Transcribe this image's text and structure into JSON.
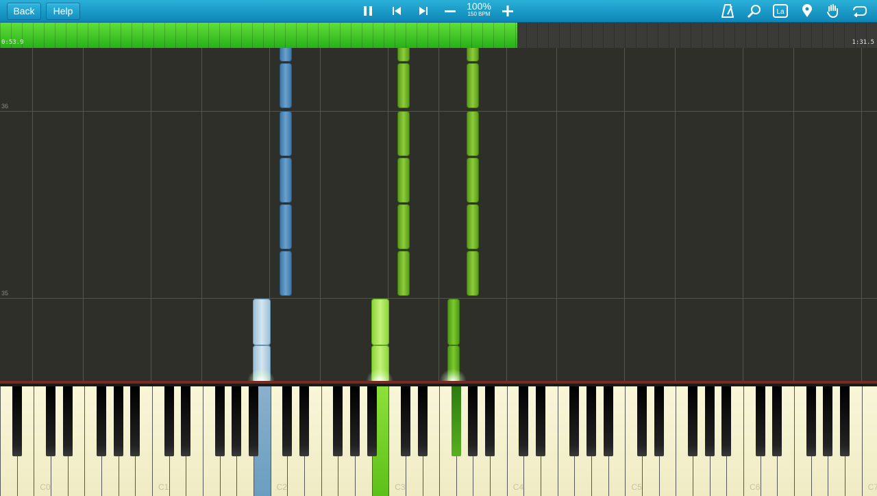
{
  "toolbar": {
    "back_label": "Back",
    "help_label": "Help",
    "speed_percent": "100%",
    "speed_bpm": "150 BPM"
  },
  "icons": [
    "pause-icon",
    "skip-back-icon",
    "skip-forward-icon",
    "minus-icon",
    "plus-icon",
    "metronome-icon",
    "search-icon",
    "note-label-icon",
    "location-pin-icon",
    "hand-icon",
    "loop-icon"
  ],
  "note_label_icon_text": "La",
  "timeline": {
    "current_time": "0:53.9",
    "total_time": "1:31.5",
    "progress": 0.59
  },
  "roll": {
    "measure_labels": [
      "36",
      "35"
    ]
  },
  "keyboard": {
    "octave_labels": [
      "C0",
      "C1",
      "C2",
      "C3",
      "C4",
      "C5",
      "C6",
      "C7"
    ]
  },
  "colors": {
    "left_hand": "#5a8fbf",
    "right_hand": "#7cc22a",
    "toolbar": "#1a9ccd",
    "progress": "#3cc822"
  }
}
